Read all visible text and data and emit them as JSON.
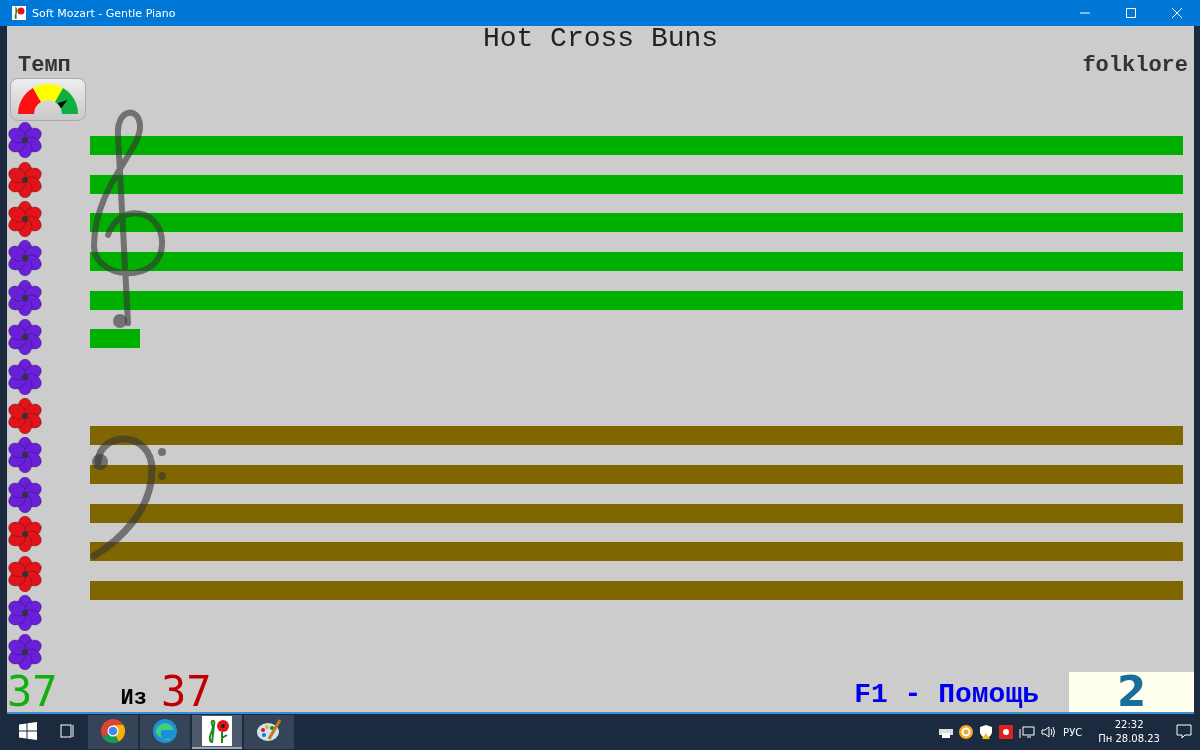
{
  "window": {
    "title": "Soft Mozart - Gentle Piano"
  },
  "song": {
    "title": "Hot Cross Buns",
    "genre": "folklore"
  },
  "tempo": {
    "label": "Темп",
    "level": 0.8
  },
  "flowers": [
    {
      "color": "#6a1fd8"
    },
    {
      "color": "#e0141a"
    },
    {
      "color": "#e0141a"
    },
    {
      "color": "#6a1fd8"
    },
    {
      "color": "#6a1fd8"
    },
    {
      "color": "#6a1fd8"
    },
    {
      "color": "#6a1fd8"
    },
    {
      "color": "#e0141a"
    },
    {
      "color": "#6a1fd8"
    },
    {
      "color": "#6a1fd8"
    },
    {
      "color": "#e0141a"
    },
    {
      "color": "#e0141a"
    },
    {
      "color": "#6a1fd8"
    },
    {
      "color": "#6a1fd8"
    }
  ],
  "staves": [
    {
      "kind": "treble",
      "color": "#00b000"
    },
    {
      "kind": "bass",
      "color": "#806600"
    }
  ],
  "footer": {
    "current": "37",
    "of_label": "Из",
    "total": "37",
    "help": "F1 - Помощь",
    "counter": "2"
  },
  "taskbar": {
    "apps": [
      {
        "kind": "chrome",
        "selected": false
      },
      {
        "kind": "edge",
        "selected": false
      },
      {
        "kind": "mozart",
        "selected": true
      },
      {
        "kind": "paint",
        "selected": false
      }
    ],
    "language": "РУС",
    "time": "22:32",
    "date": "Пн 28.08.23"
  }
}
